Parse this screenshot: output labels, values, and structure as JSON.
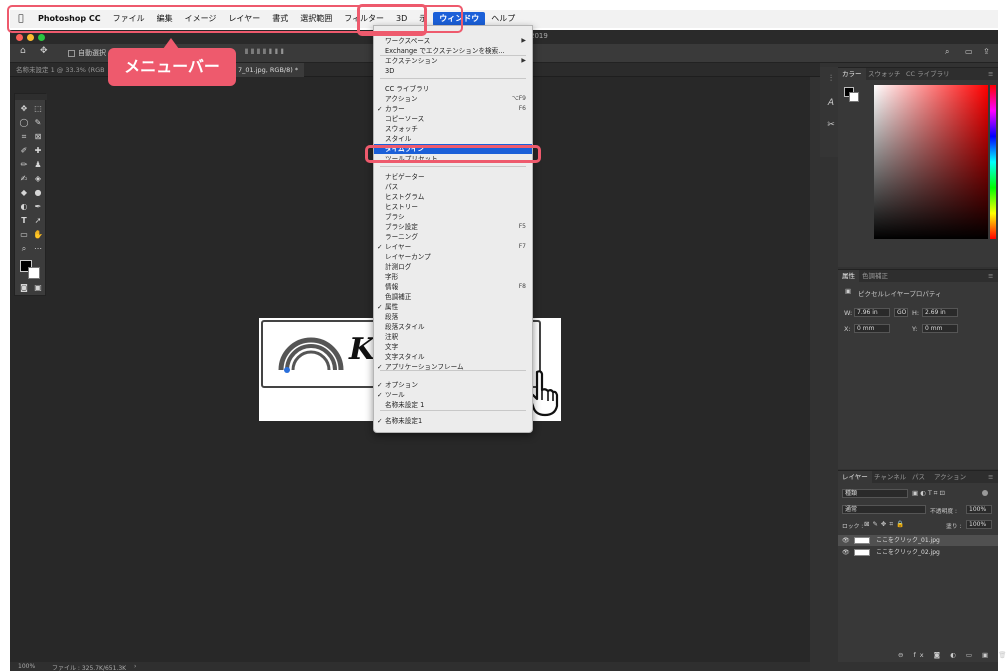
{
  "menubar": {
    "app_name": "Photoshop CC",
    "items": [
      "ファイル",
      "編集",
      "イメージ",
      "レイヤー",
      "書式",
      "選択範囲",
      "フィルター",
      "3D",
      "示",
      "ウィンドウ",
      "ヘルプ"
    ]
  },
  "window": {
    "title_fragment": "2019"
  },
  "options_bar": {
    "auto_select_label": "自動選択 :"
  },
  "tabs": {
    "doc1": "名称未設定 1 @ 33.3% (RGB",
    "doc2": "7_01.jpg, RGB/8) *"
  },
  "status": {
    "zoom": "100%",
    "file_info": "ファイル : 325.7K/651.3K"
  },
  "doc_text": {
    "logo_letter": "K"
  },
  "color_panel": {
    "tabs": [
      "カラー",
      "スウォッチ",
      "CC ライブラリ"
    ]
  },
  "properties_panel": {
    "tabs": [
      "属性",
      "色調補正"
    ],
    "subtitle": "ピクセルレイヤープロパティ",
    "w_label": "W:",
    "w_value": "7.96 in",
    "link_label": "GO",
    "h_label": "H:",
    "h_value": "2.69 in",
    "x_label": "X:",
    "x_value": "0 mm",
    "y_label": "Y:",
    "y_value": "0 mm"
  },
  "layers_panel": {
    "tabs": [
      "レイヤー",
      "チャンネル",
      "パス",
      "アクション"
    ],
    "filter_kind": "種類",
    "blend_mode": "通常",
    "opacity_label": "不透明度 :",
    "opacity_value": "100%",
    "lock_label": "ロック :",
    "fill_label": "塗り :",
    "fill_value": "100%",
    "layers": [
      {
        "name": "ここをクリック_01.jpg",
        "selected": true
      },
      {
        "name": "ここをクリック_02.jpg",
        "selected": false
      }
    ]
  },
  "window_menu": {
    "items": [
      {
        "label": "ワークスペース",
        "arrow": "▶",
        "checked": false,
        "shortcut": ""
      },
      {
        "label": "Exchange でエクステンションを検索...",
        "checked": false,
        "shortcut": ""
      },
      {
        "label": "エクステンション",
        "arrow": "▶",
        "checked": false,
        "shortcut": ""
      },
      {
        "label": "3D",
        "checked": false,
        "shortcut": ""
      },
      {
        "label": "CC ライブラリ",
        "checked": false,
        "shortcut": ""
      },
      {
        "label": "アクション",
        "checked": false,
        "shortcut": "⌥F9"
      },
      {
        "label": "カラー",
        "checked": true,
        "shortcut": "F6"
      },
      {
        "label": "コピーソース",
        "checked": false,
        "shortcut": ""
      },
      {
        "label": "スウォッチ",
        "checked": false,
        "shortcut": ""
      },
      {
        "label": "スタイル",
        "checked": false,
        "shortcut": ""
      },
      {
        "label": "タイムライン",
        "checked": false,
        "shortcut": "",
        "highlighted": true
      },
      {
        "label": "ツールプリセット",
        "checked": false,
        "shortcut": ""
      },
      {
        "label": "ナビゲーター",
        "checked": false,
        "shortcut": ""
      },
      {
        "label": "パス",
        "checked": false,
        "shortcut": ""
      },
      {
        "label": "ヒストグラム",
        "checked": false,
        "shortcut": ""
      },
      {
        "label": "ヒストリー",
        "checked": false,
        "shortcut": ""
      },
      {
        "label": "ブラシ",
        "checked": false,
        "shortcut": ""
      },
      {
        "label": "ブラシ設定",
        "checked": false,
        "shortcut": "F5"
      },
      {
        "label": "ラーニング",
        "checked": false,
        "shortcut": ""
      },
      {
        "label": "レイヤー",
        "checked": true,
        "shortcut": "F7"
      },
      {
        "label": "レイヤーカンプ",
        "checked": false,
        "shortcut": ""
      },
      {
        "label": "計測ログ",
        "checked": false,
        "shortcut": ""
      },
      {
        "label": "字形",
        "checked": false,
        "shortcut": ""
      },
      {
        "label": "情報",
        "checked": false,
        "shortcut": "F8"
      },
      {
        "label": "色調補正",
        "checked": false,
        "shortcut": ""
      },
      {
        "label": "属性",
        "checked": true,
        "shortcut": ""
      },
      {
        "label": "段落",
        "checked": false,
        "shortcut": ""
      },
      {
        "label": "段落スタイル",
        "checked": false,
        "shortcut": ""
      },
      {
        "label": "注釈",
        "checked": false,
        "shortcut": ""
      },
      {
        "label": "文字",
        "checked": false,
        "shortcut": ""
      },
      {
        "label": "文字スタイル",
        "checked": false,
        "shortcut": ""
      },
      {
        "label": "アプリケーションフレーム",
        "checked": true,
        "shortcut": ""
      },
      {
        "label": "オプション",
        "checked": true,
        "shortcut": ""
      },
      {
        "label": "ツール",
        "checked": true,
        "shortcut": ""
      },
      {
        "label": "名称未設定 1",
        "checked": false,
        "shortcut": ""
      },
      {
        "label": "名称未設定1",
        "checked": true,
        "shortcut": ""
      }
    ]
  },
  "annotation": {
    "callout_text": "メニューバー"
  },
  "colors": {
    "accent_blue": "#1a5fd8",
    "annotation_red": "#ee5a6d",
    "ps_bg": "#323232"
  }
}
